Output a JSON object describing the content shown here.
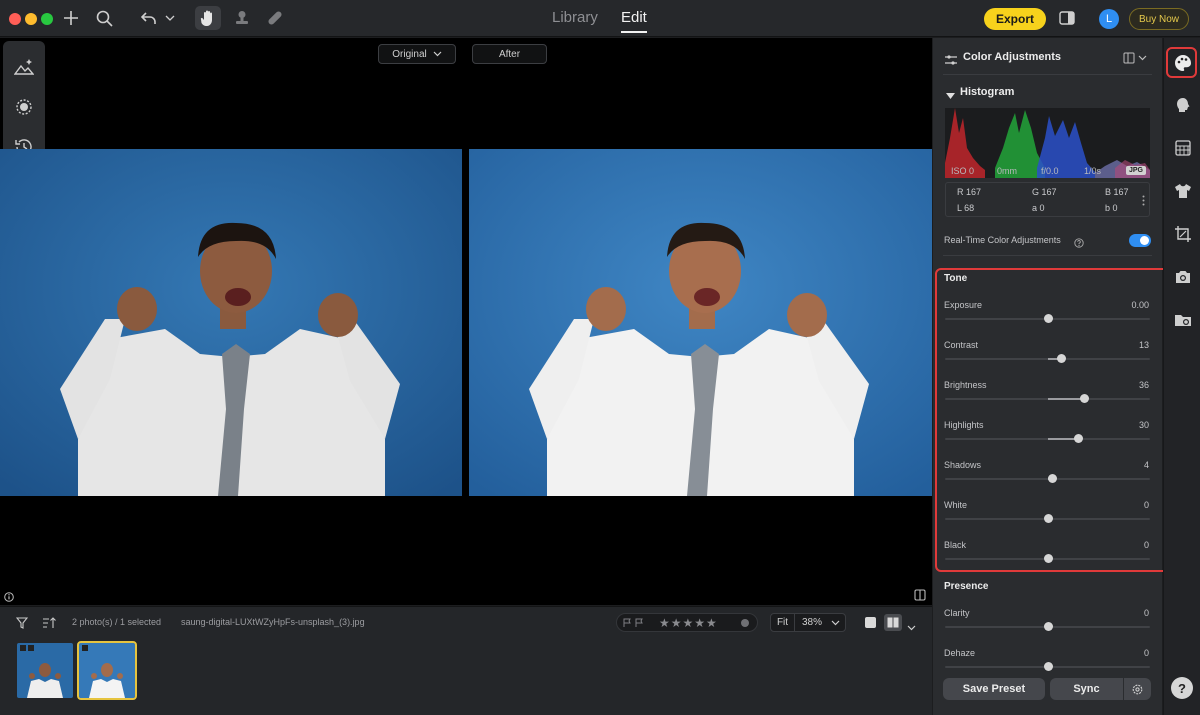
{
  "window": {
    "tabs": [
      {
        "label": "Library",
        "active": false
      },
      {
        "label": "Edit",
        "active": true
      }
    ],
    "export_label": "Export",
    "avatar_initial": "L",
    "buy_label": "Buy Now"
  },
  "toolbar_icons": [
    "plus-icon",
    "search-icon",
    "undo-icon",
    "chevron-down-icon",
    "hand-icon",
    "stamp-icon",
    "bandage-icon"
  ],
  "canvas": {
    "original_label": "Original",
    "after_label": "After"
  },
  "filmstrip": {
    "count_text": "2 photo(s) / 1 selected",
    "filename": "saung-digital-LUXtWZyHpFs-unsplash_(3).jpg",
    "rating": 0,
    "zoom_fit_label": "Fit",
    "zoom_value": "38%"
  },
  "panel": {
    "title": "Color Adjustments",
    "histogram": {
      "title": "Histogram",
      "iso": "ISO 0",
      "focal": "0mm",
      "aperture": "f/0.0",
      "shutter": "1/0s",
      "format": "JPG"
    },
    "readout": {
      "r": "R 167",
      "g": "G 167",
      "b": "B 167",
      "l": "L 68",
      "a": "a 0",
      "b2": "b 0"
    },
    "realtime_label": "Real-Time Color Adjustments",
    "realtime_on": true,
    "tone": {
      "title": "Tone",
      "sliders": [
        {
          "label": "Exposure",
          "value": "0.00",
          "pos": 0
        },
        {
          "label": "Contrast",
          "value": "13",
          "pos": 13
        },
        {
          "label": "Brightness",
          "value": "36",
          "pos": 36
        },
        {
          "label": "Highlights",
          "value": "30",
          "pos": 30
        },
        {
          "label": "Shadows",
          "value": "4",
          "pos": 4
        },
        {
          "label": "White",
          "value": "0",
          "pos": 0
        },
        {
          "label": "Black",
          "value": "0",
          "pos": 0
        }
      ]
    },
    "presence": {
      "title": "Presence",
      "sliders": [
        {
          "label": "Clarity",
          "value": "0",
          "pos": 0
        },
        {
          "label": "Dehaze",
          "value": "0",
          "pos": 0
        }
      ]
    },
    "save_preset_label": "Save Preset",
    "sync_label": "Sync"
  },
  "rail_icons": [
    "palette-icon",
    "face-icon",
    "texture-icon",
    "shirt-icon",
    "crop-icon",
    "camera-icon",
    "folder-icon"
  ],
  "help_label": "?",
  "colors": {
    "accent_blue": "#2f8ef2",
    "export_yellow": "#f7d21c",
    "highlight_red": "#e03a3a",
    "backdrop_blue": "#2b6ea8"
  }
}
